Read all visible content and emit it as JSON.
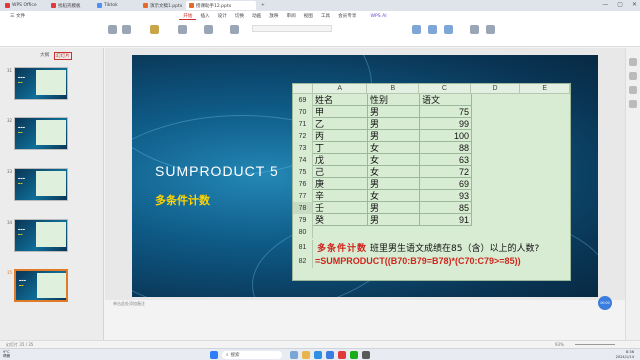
{
  "tabs": [
    {
      "label": "WPS Office",
      "color": "#e2393b",
      "active": false
    },
    {
      "label": "找稻壳模板",
      "color": "#e2393b",
      "active": false
    },
    {
      "label": "Tiktok",
      "color": "#4d8ff5",
      "active": false
    },
    {
      "label": "演示文稿1.pptx",
      "color": "#e36a2b",
      "active": false
    },
    {
      "label": "授课助手12.pptx",
      "color": "#e36a2b",
      "active": true
    }
  ],
  "menu": {
    "file": "三 文件",
    "items": [
      "开始",
      "插入",
      "设计",
      "切换",
      "动画",
      "放映",
      "审阅",
      "视图",
      "工具",
      "会员专享"
    ],
    "active_index": 0,
    "ai": "WPS AI"
  },
  "left_pane": {
    "tab_outline": "大纲",
    "tab_slides": "幻灯片",
    "thumb_numbers": [
      "31",
      "32",
      "33",
      "34",
      "35"
    ],
    "selected_index": 4
  },
  "slide": {
    "title": "SUMPRODUCT 5",
    "subtitle": "多条件计数",
    "columns": [
      "A",
      "B",
      "C",
      "D",
      "E"
    ],
    "rows": [
      {
        "n": "69",
        "a": "姓名",
        "b": "性别",
        "c": "语文"
      },
      {
        "n": "70",
        "a": "甲",
        "b": "男",
        "c": "75"
      },
      {
        "n": "71",
        "a": "乙",
        "b": "男",
        "c": "99"
      },
      {
        "n": "72",
        "a": "丙",
        "b": "男",
        "c": "100"
      },
      {
        "n": "73",
        "a": "丁",
        "b": "女",
        "c": "88"
      },
      {
        "n": "74",
        "a": "戊",
        "b": "女",
        "c": "63"
      },
      {
        "n": "75",
        "a": "己",
        "b": "女",
        "c": "72"
      },
      {
        "n": "76",
        "a": "庚",
        "b": "男",
        "c": "69"
      },
      {
        "n": "77",
        "a": "辛",
        "b": "女",
        "c": "93"
      },
      {
        "n": "78",
        "a": "壬",
        "b": "男",
        "c": "85"
      },
      {
        "n": "79",
        "a": "癸",
        "b": "男",
        "c": "91"
      }
    ],
    "row80": "80",
    "row81": "81",
    "row82": "82",
    "question_prefix": "多条件计数",
    "question_text": "班里男生语文成绩在85（含）以上的人数?",
    "formula": "=SUMPRODUCT((B70:B79=B78)*(C70:C79>=85))"
  },
  "notes_placeholder": "单击此处添加备注",
  "status": {
    "slide_counter": "幻灯片 35 / 35",
    "zoom": "93%"
  },
  "taskbar": {
    "weather_temp": "9°C",
    "weather_desc": "晴朗",
    "search_placeholder": "搜索",
    "time": "8:36",
    "date": "2024/1/14"
  },
  "record_label": "00:00"
}
